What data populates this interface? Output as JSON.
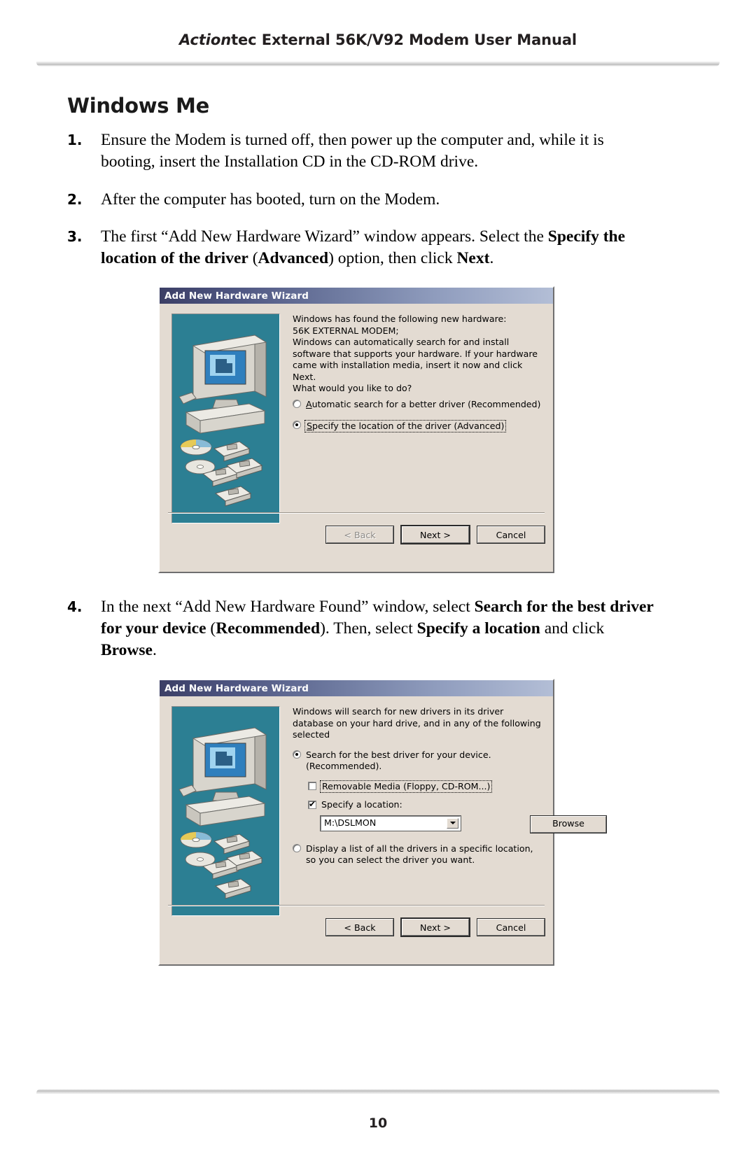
{
  "header": {
    "title_italic": "Action",
    "title_rest": "tec External 56K/V92 Modem User Manual"
  },
  "section": {
    "heading": "Windows Me"
  },
  "steps": [
    {
      "number": "1.",
      "text": "Ensure the Modem is turned off, then power up the computer and, while it is booting, insert the Installation CD in the CD-ROM drive."
    },
    {
      "number": "2.",
      "text": "After the computer has booted, turn on the Modem."
    },
    {
      "number": "3.",
      "part1": "The first “Add New Hardware Wizard” window appears. Select the ",
      "bold1": "Specify the location of the driver",
      "part2": " (",
      "bold2": "Advanced",
      "part3": ") option, then click ",
      "bold3": "Next",
      "part4": "."
    },
    {
      "number": "4.",
      "part1": "In the next “Add New Hardware Found” window, select ",
      "bold1": "Search for the best driver for your device",
      "part2": " (",
      "bold2": "Recommended",
      "part3": "). Then, select ",
      "bold3": "Specify a location",
      "part4": " and click ",
      "bold4": "Browse",
      "part5": "."
    }
  ],
  "dialog1": {
    "title": "Add New Hardware Wizard",
    "intro": "Windows has found the following new hardware:",
    "device": "56K EXTERNAL MODEM;",
    "description": "Windows can automatically search for and install software that supports your hardware. If your hardware came with installation media, insert it now and click Next.",
    "question": "What would you like to do?",
    "options": [
      {
        "label_prefix": "A",
        "label": "utomatic search for a better driver (Recommended)",
        "selected": false,
        "focused": false
      },
      {
        "label_prefix": "S",
        "label": "pecify the location of the driver (Advanced)",
        "selected": true,
        "focused": true
      }
    ],
    "buttons": {
      "back": "< Back",
      "back_accel": "B",
      "next": "Next >",
      "cancel": "Cancel"
    }
  },
  "dialog2": {
    "title": "Add New Hardware Wizard",
    "description": "Windows will search for new drivers in its driver database on your hard drive, and in any of the following selected",
    "option_search": "Search for the best driver for your device. (Recommended).",
    "checkbox_removable": "Removable Media (Floppy, CD-ROM...)",
    "checkbox_removable_accel": "M",
    "checkbox_location": "Specify a location:",
    "checkbox_location_accel": "l",
    "location_value": "M:\\DSLMON",
    "browse_label": "Browse",
    "browse_accel": "r",
    "option_display": "Display a list of all the drivers in a specific location, so you can select the driver you want.",
    "option_display_accel": "D",
    "buttons": {
      "back": "< Back",
      "back_accel": "B",
      "next": "Next >",
      "cancel": "Cancel"
    }
  },
  "footer": {
    "page_number": "10"
  },
  "colors": {
    "banner": "#2c7f93",
    "dialog_face": "#e3dbd2",
    "titlebar_start": "#3c3f66",
    "titlebar_end": "#b3bed6"
  }
}
